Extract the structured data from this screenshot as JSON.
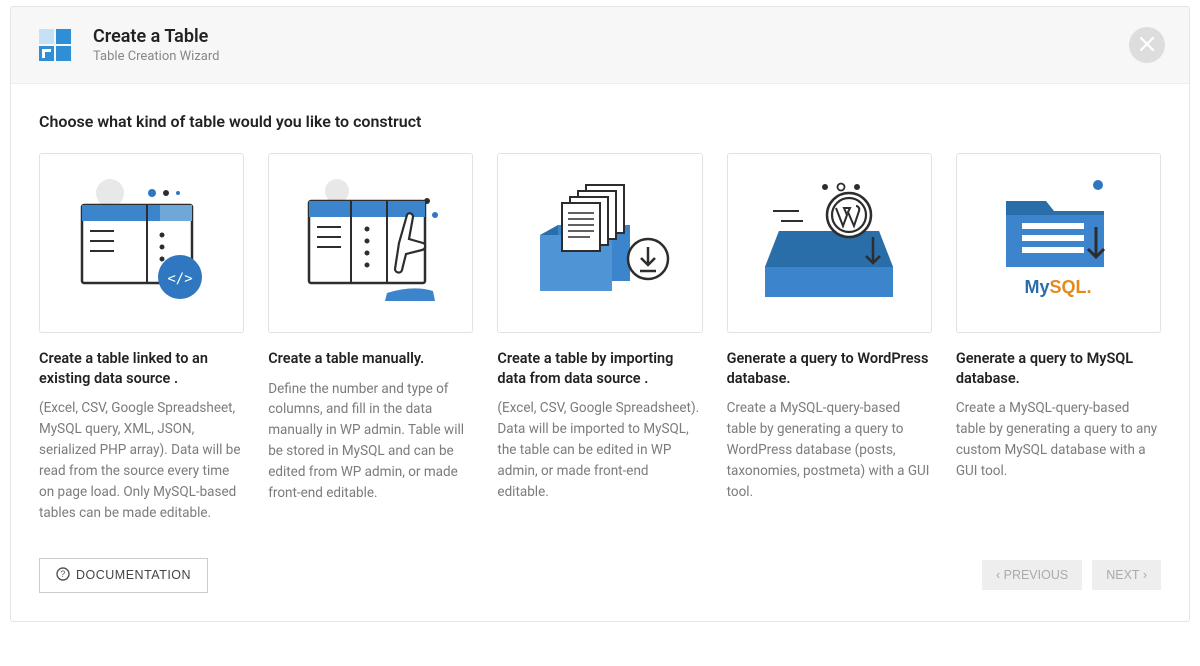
{
  "header": {
    "title": "Create a Table",
    "subtitle": "Table Creation Wizard"
  },
  "prompt": "Choose what kind of table would you like to construct",
  "options": [
    {
      "title": "Create a table linked to an existing data source .",
      "desc": "(Excel, CSV, Google Spreadsheet, MySQL query, XML, JSON, serialized PHP array). Data will be read from the source every time on page load. Only MySQL-based tables can be made editable."
    },
    {
      "title": "Create a table manually.",
      "desc": "Define the number and type of columns, and fill in the data manually in WP admin. Table will be stored in MySQL and can be edited from WP admin, or made front-end editable."
    },
    {
      "title": "Create a table by importing data from data source .",
      "desc": "(Excel, CSV, Google Spreadsheet). Data will be imported to MySQL, the table can be edited in WP admin, or made front-end editable."
    },
    {
      "title": "Generate a query to WordPress database.",
      "desc": "Create a MySQL-query-based table by generating a query to WordPress database (posts, taxonomies, postmeta) with a GUI tool."
    },
    {
      "title": "Generate a query to MySQL database.",
      "desc": "Create a MySQL-query-based table by generating a query to any custom MySQL database with a GUI tool."
    }
  ],
  "footer": {
    "documentation": "DOCUMENTATION",
    "previous": "PREVIOUS",
    "next": "NEXT"
  }
}
